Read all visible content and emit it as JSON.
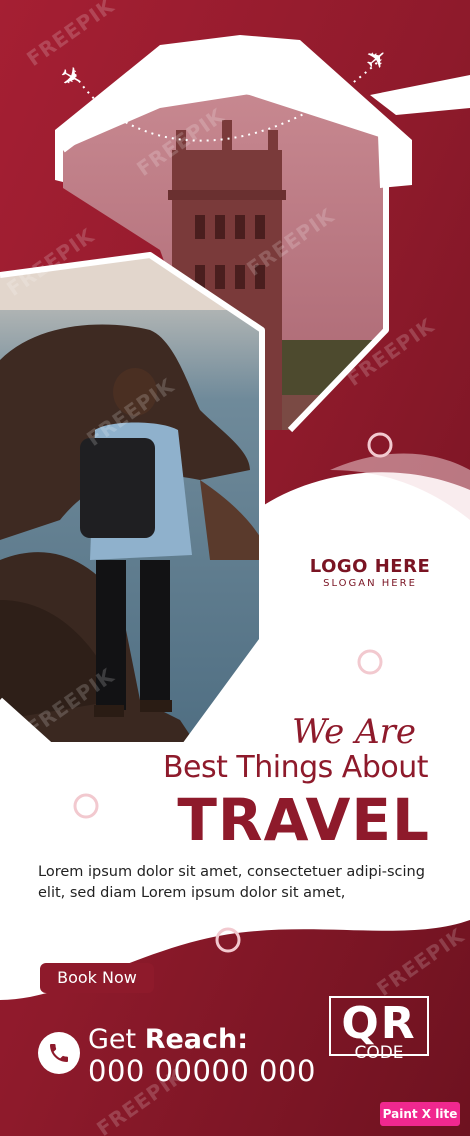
{
  "logo": {
    "title": "LOGO HERE",
    "slogan": "SLOGAN HERE"
  },
  "headline": {
    "script": "We Are",
    "line1": "Best Things About",
    "line2": "TRAVEL"
  },
  "body_text": "Lorem ipsum dolor sit amet, consectetuer adipi-scing elit, sed diam Lorem ipsum dolor sit amet,",
  "cta": {
    "button_label": "Book Now"
  },
  "contact": {
    "label_light": "Get ",
    "label_bold": "Reach:",
    "phone": "000 00000 000",
    "icon": "phone-icon"
  },
  "qr": {
    "big": "QR",
    "small": "CODE"
  },
  "badge": "Paint X lite",
  "watermark": "FREEPIK",
  "colors": {
    "brand": "#8e1a2b",
    "brand_dark": "#6e1220",
    "white": "#ffffff",
    "badge": "#f0288f"
  }
}
